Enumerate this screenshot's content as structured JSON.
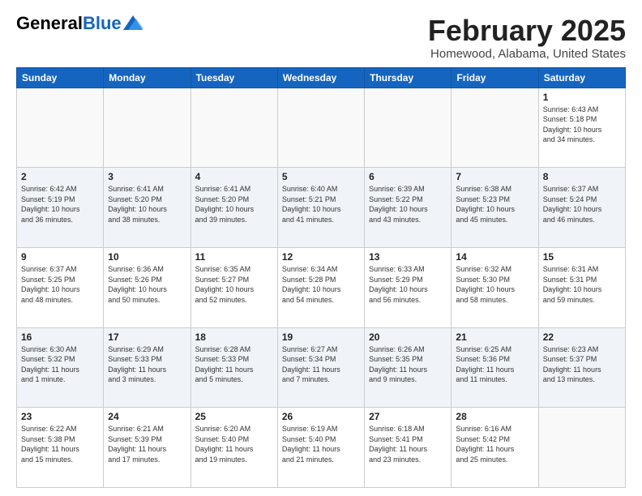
{
  "header": {
    "logo_general": "General",
    "logo_blue": "Blue",
    "month": "February 2025",
    "location": "Homewood, Alabama, United States"
  },
  "weekdays": [
    "Sunday",
    "Monday",
    "Tuesday",
    "Wednesday",
    "Thursday",
    "Friday",
    "Saturday"
  ],
  "weeks": [
    [
      {
        "day": "",
        "info": ""
      },
      {
        "day": "",
        "info": ""
      },
      {
        "day": "",
        "info": ""
      },
      {
        "day": "",
        "info": ""
      },
      {
        "day": "",
        "info": ""
      },
      {
        "day": "",
        "info": ""
      },
      {
        "day": "1",
        "info": "Sunrise: 6:43 AM\nSunset: 5:18 PM\nDaylight: 10 hours\nand 34 minutes."
      }
    ],
    [
      {
        "day": "2",
        "info": "Sunrise: 6:42 AM\nSunset: 5:19 PM\nDaylight: 10 hours\nand 36 minutes."
      },
      {
        "day": "3",
        "info": "Sunrise: 6:41 AM\nSunset: 5:20 PM\nDaylight: 10 hours\nand 38 minutes."
      },
      {
        "day": "4",
        "info": "Sunrise: 6:41 AM\nSunset: 5:20 PM\nDaylight: 10 hours\nand 39 minutes."
      },
      {
        "day": "5",
        "info": "Sunrise: 6:40 AM\nSunset: 5:21 PM\nDaylight: 10 hours\nand 41 minutes."
      },
      {
        "day": "6",
        "info": "Sunrise: 6:39 AM\nSunset: 5:22 PM\nDaylight: 10 hours\nand 43 minutes."
      },
      {
        "day": "7",
        "info": "Sunrise: 6:38 AM\nSunset: 5:23 PM\nDaylight: 10 hours\nand 45 minutes."
      },
      {
        "day": "8",
        "info": "Sunrise: 6:37 AM\nSunset: 5:24 PM\nDaylight: 10 hours\nand 46 minutes."
      }
    ],
    [
      {
        "day": "9",
        "info": "Sunrise: 6:37 AM\nSunset: 5:25 PM\nDaylight: 10 hours\nand 48 minutes."
      },
      {
        "day": "10",
        "info": "Sunrise: 6:36 AM\nSunset: 5:26 PM\nDaylight: 10 hours\nand 50 minutes."
      },
      {
        "day": "11",
        "info": "Sunrise: 6:35 AM\nSunset: 5:27 PM\nDaylight: 10 hours\nand 52 minutes."
      },
      {
        "day": "12",
        "info": "Sunrise: 6:34 AM\nSunset: 5:28 PM\nDaylight: 10 hours\nand 54 minutes."
      },
      {
        "day": "13",
        "info": "Sunrise: 6:33 AM\nSunset: 5:29 PM\nDaylight: 10 hours\nand 56 minutes."
      },
      {
        "day": "14",
        "info": "Sunrise: 6:32 AM\nSunset: 5:30 PM\nDaylight: 10 hours\nand 58 minutes."
      },
      {
        "day": "15",
        "info": "Sunrise: 6:31 AM\nSunset: 5:31 PM\nDaylight: 10 hours\nand 59 minutes."
      }
    ],
    [
      {
        "day": "16",
        "info": "Sunrise: 6:30 AM\nSunset: 5:32 PM\nDaylight: 11 hours\nand 1 minute."
      },
      {
        "day": "17",
        "info": "Sunrise: 6:29 AM\nSunset: 5:33 PM\nDaylight: 11 hours\nand 3 minutes."
      },
      {
        "day": "18",
        "info": "Sunrise: 6:28 AM\nSunset: 5:33 PM\nDaylight: 11 hours\nand 5 minutes."
      },
      {
        "day": "19",
        "info": "Sunrise: 6:27 AM\nSunset: 5:34 PM\nDaylight: 11 hours\nand 7 minutes."
      },
      {
        "day": "20",
        "info": "Sunrise: 6:26 AM\nSunset: 5:35 PM\nDaylight: 11 hours\nand 9 minutes."
      },
      {
        "day": "21",
        "info": "Sunrise: 6:25 AM\nSunset: 5:36 PM\nDaylight: 11 hours\nand 11 minutes."
      },
      {
        "day": "22",
        "info": "Sunrise: 6:23 AM\nSunset: 5:37 PM\nDaylight: 11 hours\nand 13 minutes."
      }
    ],
    [
      {
        "day": "23",
        "info": "Sunrise: 6:22 AM\nSunset: 5:38 PM\nDaylight: 11 hours\nand 15 minutes."
      },
      {
        "day": "24",
        "info": "Sunrise: 6:21 AM\nSunset: 5:39 PM\nDaylight: 11 hours\nand 17 minutes."
      },
      {
        "day": "25",
        "info": "Sunrise: 6:20 AM\nSunset: 5:40 PM\nDaylight: 11 hours\nand 19 minutes."
      },
      {
        "day": "26",
        "info": "Sunrise: 6:19 AM\nSunset: 5:40 PM\nDaylight: 11 hours\nand 21 minutes."
      },
      {
        "day": "27",
        "info": "Sunrise: 6:18 AM\nSunset: 5:41 PM\nDaylight: 11 hours\nand 23 minutes."
      },
      {
        "day": "28",
        "info": "Sunrise: 6:16 AM\nSunset: 5:42 PM\nDaylight: 11 hours\nand 25 minutes."
      },
      {
        "day": "",
        "info": ""
      }
    ]
  ]
}
